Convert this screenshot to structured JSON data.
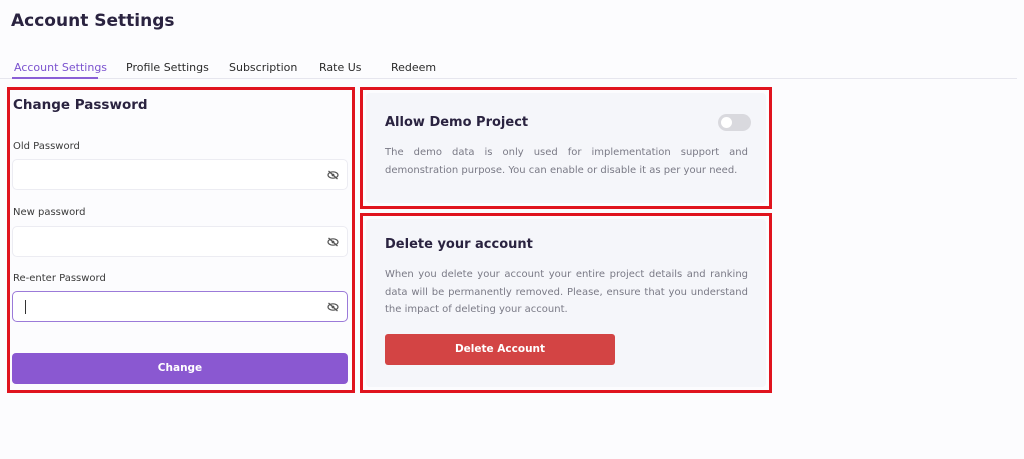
{
  "page": {
    "title": "Account Settings"
  },
  "tabs": [
    {
      "label": "Account Settings",
      "active": true
    },
    {
      "label": "Profile Settings",
      "active": false
    },
    {
      "label": "Subscription",
      "active": false
    },
    {
      "label": "Rate Us",
      "active": false
    },
    {
      "label": "Redeem",
      "active": false
    }
  ],
  "change_password": {
    "title": "Change Password",
    "old_password": {
      "label": "Old Password",
      "value": "",
      "placeholder": "",
      "icon": "eye-slash-icon"
    },
    "new_password": {
      "label": "New password",
      "value": "",
      "placeholder": "",
      "icon": "eye-slash-icon"
    },
    "reenter_password": {
      "label": "Re-enter Password",
      "value": "",
      "placeholder": "",
      "icon": "eye-slash-icon",
      "focused": true
    },
    "button_label": "Change"
  },
  "demo_project": {
    "title": "Allow Demo Project",
    "description": "The demo data is only used for implementation support and demonstration purpose. You can enable or disable it as per your need.",
    "enabled": false
  },
  "delete_account": {
    "title": "Delete your account",
    "description": "When you delete your account your entire project details and ranking data will be permanently removed. Please, ensure that you understand the impact of deleting your account.",
    "button_label": "Delete Account"
  },
  "colors": {
    "accent": "#8a58d1",
    "danger": "#d34444",
    "highlight": "#e0141e",
    "toggle_off": "#d9d9de"
  }
}
